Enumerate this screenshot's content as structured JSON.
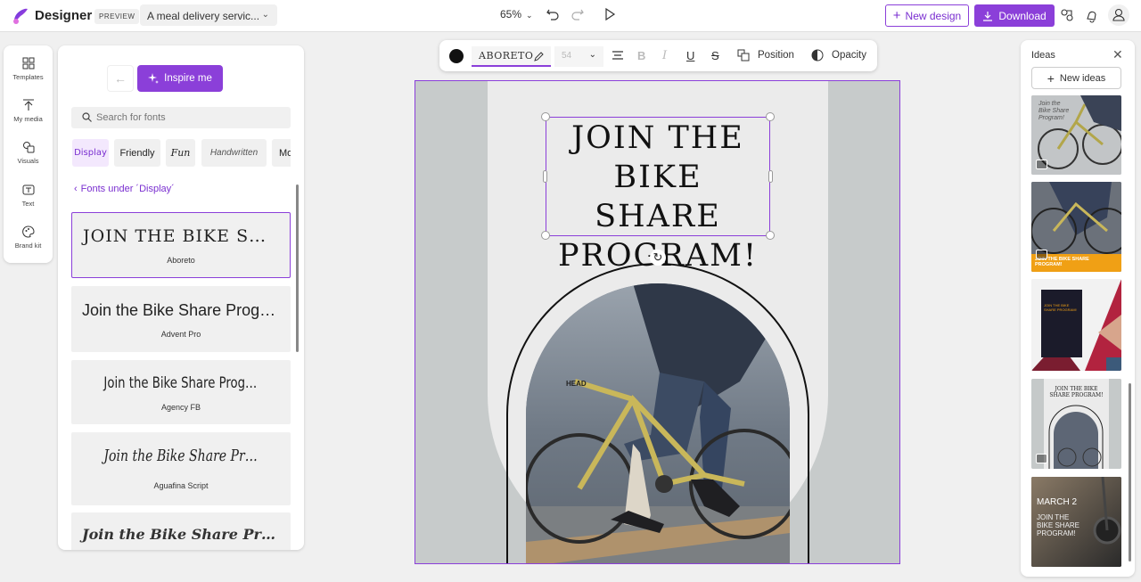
{
  "app": {
    "brand": "Designer",
    "preview_badge": "PREVIEW",
    "doc_name": "A meal delivery servic...",
    "zoom": "65%",
    "new_design": "New design",
    "download": "Download"
  },
  "rail": {
    "items": [
      {
        "label": "Templates",
        "icon": "templates-icon"
      },
      {
        "label": "My media",
        "icon": "upload-icon"
      },
      {
        "label": "Visuals",
        "icon": "visuals-icon"
      },
      {
        "label": "Text",
        "icon": "text-icon"
      },
      {
        "label": "Brand kit",
        "icon": "palette-icon"
      }
    ]
  },
  "fonts_panel": {
    "inspire_label": "Inspire me",
    "search_placeholder": "Search for fonts",
    "chips": [
      "Display",
      "Friendly",
      "Fun",
      "Handwritten",
      "Mo"
    ],
    "active_chip": "Display",
    "fonts_under": "Fonts under ´Display´",
    "sample_text": "Join the Bike Share Program!",
    "fonts": [
      {
        "sample": "JOIN THE BIKE SHAR...",
        "name": "Aboreto",
        "selected": true
      },
      {
        "sample": "Join the Bike Share Program!",
        "name": "Advent Pro",
        "selected": false
      },
      {
        "sample": "Join the Bike Share Program!",
        "name": "Agency FB",
        "selected": false
      },
      {
        "sample": "Join the Bike Share Program:",
        "name": "Aguafina Script",
        "selected": false
      },
      {
        "sample": "Join the Bike Share Program!",
        "name": "",
        "selected": false
      }
    ]
  },
  "format_toolbar": {
    "color": "#000000",
    "font": "ABORETO",
    "size": "54",
    "position_label": "Position",
    "opacity_label": "Opacity"
  },
  "canvas": {
    "headline_lines": [
      "JOIN THE",
      "BIKE SHARE",
      "PROGRAM!"
    ],
    "photo_label": "HEAD"
  },
  "ideas": {
    "title": "Ideas",
    "new_ideas": "New ideas",
    "thumbs": [
      {
        "text": "Join the Bike Share Program!"
      },
      {
        "text": "JOIN THE BIKE SHARE PROGRAM!"
      },
      {
        "text": "JOIN THE BIKE SHARE PROGRAM!"
      },
      {
        "text": "JOIN THE BIKE SHARE PROGRAM!"
      },
      {
        "text_top": "MARCH 2",
        "text_bottom": "JOIN THE BIKE SHARE PROGRAM!"
      }
    ]
  },
  "colors": {
    "accent": "#8b3fd9",
    "canvas_bg": "#c7cbcb",
    "poster_bg": "#ebebeb"
  }
}
